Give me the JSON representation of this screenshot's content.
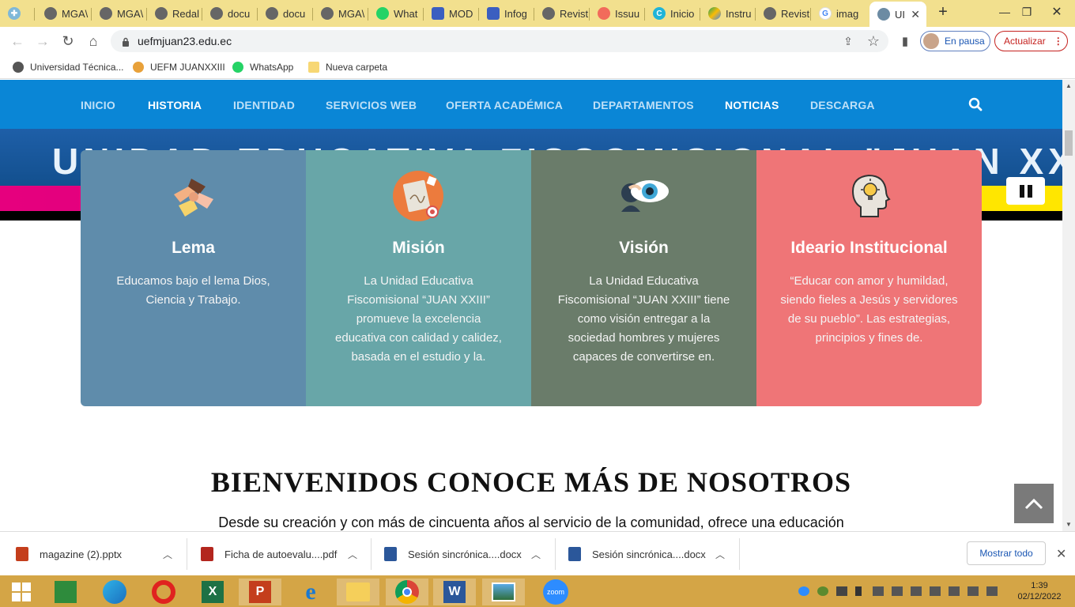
{
  "browser": {
    "tabs": [
      {
        "label": "",
        "icon": "puzzle-icon"
      },
      {
        "label": "MGA\\",
        "icon": "globe-icon"
      },
      {
        "label": "MGA\\",
        "icon": "globe-icon"
      },
      {
        "label": "Redal",
        "icon": "globe-icon"
      },
      {
        "label": "docu",
        "icon": "globe-icon"
      },
      {
        "label": "docu",
        "icon": "globe-icon"
      },
      {
        "label": "MGA\\",
        "icon": "globe-icon"
      },
      {
        "label": "What",
        "icon": "whatsapp-icon"
      },
      {
        "label": "MOD",
        "icon": "slides-icon"
      },
      {
        "label": "Infog",
        "icon": "slides-icon"
      },
      {
        "label": "Revist",
        "icon": "globe-icon"
      },
      {
        "label": "Issuu",
        "icon": "issuu-icon"
      },
      {
        "label": "Inicio",
        "icon": "canva-icon"
      },
      {
        "label": "Instru",
        "icon": "drive-icon"
      },
      {
        "label": "Revist",
        "icon": "globe-icon"
      },
      {
        "label": "imag",
        "icon": "google-icon"
      },
      {
        "label": "UI",
        "icon": "shield-icon"
      }
    ],
    "new_tab": "+",
    "url": "uefmjuan23.edu.ec",
    "profile_label": "En pausa",
    "update_label": "Actualizar",
    "bookmarks": [
      {
        "label": "Universidad Técnica..."
      },
      {
        "label": "UEFM JUANXXIII"
      },
      {
        "label": "WhatsApp"
      },
      {
        "label": "Nueva carpeta"
      }
    ]
  },
  "site": {
    "nav": [
      "INICIO",
      "HISTORIA",
      "IDENTIDAD",
      "SERVICIOS WEB",
      "OFERTA ACADÉMICA",
      "DEPARTAMENTOS",
      "NOTICIAS",
      "DESCARGA"
    ],
    "banner_text": "UNIDAD EDUCATIVA FISCOMISIONAL \"JUAN XXIII\"",
    "cards": [
      {
        "title": "Lema",
        "text": "Educamos bajo el lema Dios, Ciencia y Trabajo.",
        "color": "#5f8cab",
        "icon": "hands-icon"
      },
      {
        "title": "Misión",
        "text": "La Unidad Educativa Fiscomisional “JUAN XXIII” promueve la excelencia educativa con calidad y calidez, basada en el estudio y la.",
        "color": "#68a6a8",
        "icon": "clipboard-target-icon"
      },
      {
        "title": "Visión",
        "text": "La Unidad Educativa Fiscomisional “JUAN XXIII” tiene como visión entregar a la sociedad hombres y mujeres capaces de convertirse en.",
        "color": "#6a7c6a",
        "icon": "eye-icon"
      },
      {
        "title": "Ideario Institucional",
        "text": "“Educar con amor y humildad, siendo fieles a Jesús y servidores de su pueblo”. Las estrategias, principios y fines de.",
        "color": "#ef7577",
        "icon": "head-bulb-icon"
      }
    ],
    "welcome_title": "BIENVENIDOS CONOCE MÁS DE NOSOTROS",
    "welcome_text": "Desde su creación y con más de cincuenta años al servicio de la comunidad, ofrece una educación"
  },
  "downloads": {
    "items": [
      {
        "label": "magazine (2).pptx",
        "color": "#c43e1c"
      },
      {
        "label": "Ficha de autoevalu....pdf",
        "color": "#b3261e"
      },
      {
        "label": "Sesión sincrónica....docx",
        "color": "#2b579a"
      },
      {
        "label": "Sesión sincrónica....docx",
        "color": "#2b579a"
      }
    ],
    "show_all": "Mostrar todo"
  },
  "taskbar": {
    "time": "1:39",
    "date": "02/12/2022"
  }
}
